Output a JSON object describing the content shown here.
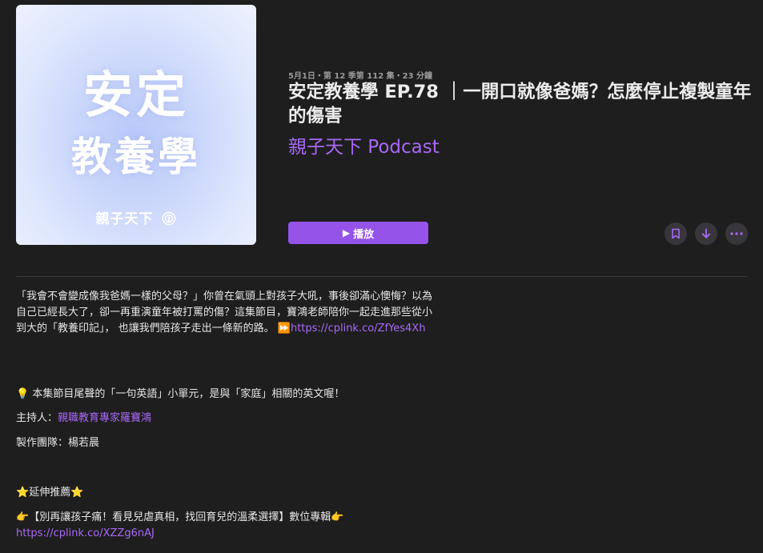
{
  "artwork": {
    "line1": "安定",
    "line2": "教養學",
    "brand": "親子天下",
    "brand_icon": "podcast-icon"
  },
  "episode": {
    "meta": "5月1日・第 12 季第 112 集・23 分鐘",
    "title": "安定教養學 EP.78 ｜一開口就像爸媽？怎麼停止複製童年的傷害",
    "show": "親子天下 Podcast"
  },
  "actions": {
    "play_label": "播放",
    "play_icon": "play-icon",
    "bookmark_icon": "bookmark-icon",
    "download_icon": "download-arrow-icon",
    "more_icon": "ellipsis-icon"
  },
  "description": {
    "p1_text": "「我會不會變成像我爸媽一樣的父母？」你曾在氣頭上對孩子大吼，事後卻滿心懊悔？以為自己已經長大了，卻一再重演童年被打罵的傷？這集節目，寶鴻老師陪你一起走進那些從小到大的「教養印記」， 也讓我們陪孩子走出一條新的路。",
    "p1_emoji": "⏩",
    "p1_link": "https://cplink.co/ZfYes4Xh",
    "p2_emoji": "💡",
    "p2_text": " 本集節目尾聲的「一句英語」小單元，是與「家庭」相關的英文喔！",
    "host_label": "主持人：",
    "host_link": "親職教育專家羅寶鴻",
    "team": "製作團隊：楊若晨",
    "rec_star": "⭐",
    "rec_text": "延伸推薦",
    "p6_emoji": "👉",
    "p6_text": "【別再讓孩子痛！看見兒虐真相，找回育兒的溫柔選擇】數位專輯",
    "p6_link": "https://cplink.co/XZZg6nAJ"
  },
  "colors": {
    "background": "#1e1e1e",
    "accent": "#9553e9",
    "link": "#a869f5"
  }
}
